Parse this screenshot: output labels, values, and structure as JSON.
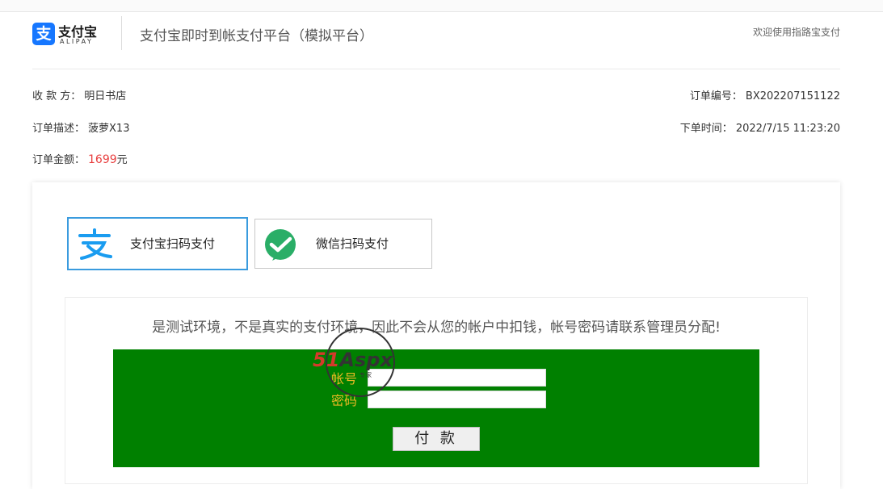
{
  "header": {
    "logo_char": "支",
    "logo_cn": "支付宝",
    "logo_en": "ALIPAY",
    "title": "支付宝即时到帐支付平台（模拟平台）",
    "welcome": "欢迎使用指路宝支付"
  },
  "order": {
    "payee_label": "收 款 方：",
    "payee": "明日书店",
    "desc_label": "订单描述：",
    "desc": "菠萝X13",
    "amount_label": "订单金额：",
    "amount": "1699",
    "amount_unit": "元",
    "order_no_label": "订单编号：",
    "order_no": "BX202207151122",
    "time_label": "下单时间：",
    "time": "2022/7/15 11:23:20"
  },
  "tabs": [
    {
      "label": "支付宝扫码支付",
      "icon": "alipay-icon",
      "active": true
    },
    {
      "label": "微信扫码支付",
      "icon": "wechat-pay-icon",
      "active": false
    }
  ],
  "form": {
    "notice": "是测试环境，不是真实的支付环境，因此不会从您的帐户中扣钱，帐号密码请联系管理员分配!",
    "account_label": "帐号",
    "account_value": "",
    "password_label": "密码",
    "password_value": "",
    "pay_button": "付 款"
  },
  "watermark": {
    "brand_num": "51",
    "brand_text": "Aspx",
    "sub": "专家"
  },
  "colors": {
    "accent": "#3a9bde",
    "amount": "#e83f3f",
    "form_bg": "#008000",
    "form_label": "#e8b923",
    "wechat_green": "#2aae67"
  }
}
